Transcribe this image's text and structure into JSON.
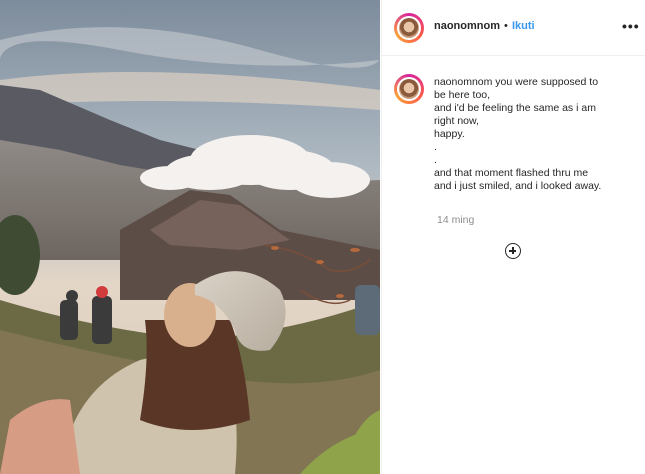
{
  "post": {
    "username": "naonomnom",
    "separator": "•",
    "follow_label": "Ikuti",
    "more_icon": "more-horizontal-icon",
    "caption": {
      "username": "naonomnom",
      "lines": [
        "you were supposed to",
        "be here too,",
        "and i'd be feeling the same as i am",
        "right now,",
        "happy.",
        ".",
        ".",
        "and that moment flashed thru me",
        "and i just smiled, and i looked away."
      ]
    },
    "timestamp": "14 ming",
    "load_more_icon": "plus-circle-icon"
  }
}
